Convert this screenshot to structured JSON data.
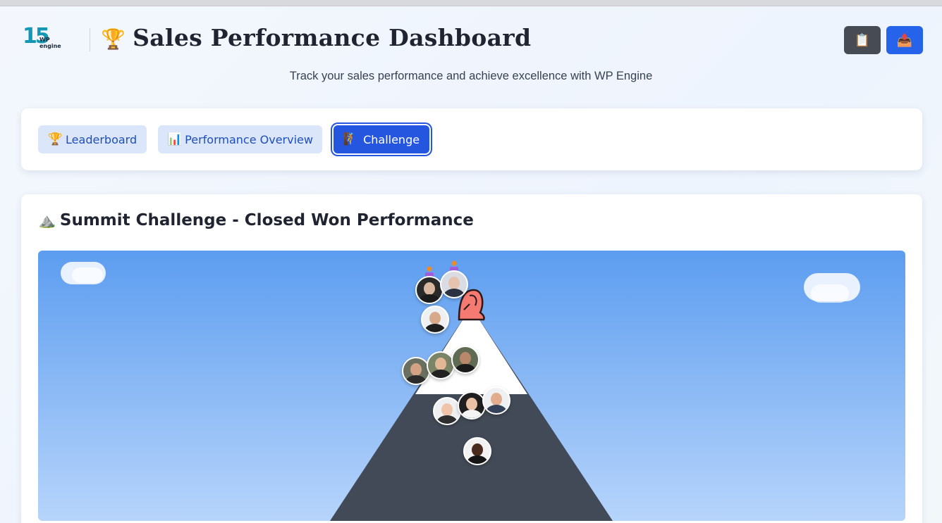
{
  "header": {
    "logo_number": "15",
    "logo_text": "WP engine",
    "title": "Sales Performance Dashboard",
    "title_icon": "🏆",
    "subtitle": "Track your sales performance and achieve excellence with WP Engine",
    "buttons": [
      {
        "icon": "clipboard-icon",
        "glyph": "📋"
      },
      {
        "icon": "export-tray-icon",
        "glyph": "📤"
      }
    ]
  },
  "tabs": [
    {
      "icon": "🏆",
      "label": "Leaderboard",
      "active": false
    },
    {
      "icon": "📊",
      "label": "Performance Overview",
      "active": false
    },
    {
      "icon": "🧗",
      "label": "Challenge",
      "active": true
    }
  ],
  "challenge": {
    "icon": "⛰️",
    "title": "Summit Challenge - Closed Won Performance"
  },
  "colors": {
    "brand_blue": "#2456e0",
    "tab_inactive_bg": "#dbe6fb",
    "mountain_rock": "#414a56",
    "mountain_snow": "#ffffff",
    "sky_top": "#5c9df0",
    "sky_bottom": "#b6d4fb"
  }
}
